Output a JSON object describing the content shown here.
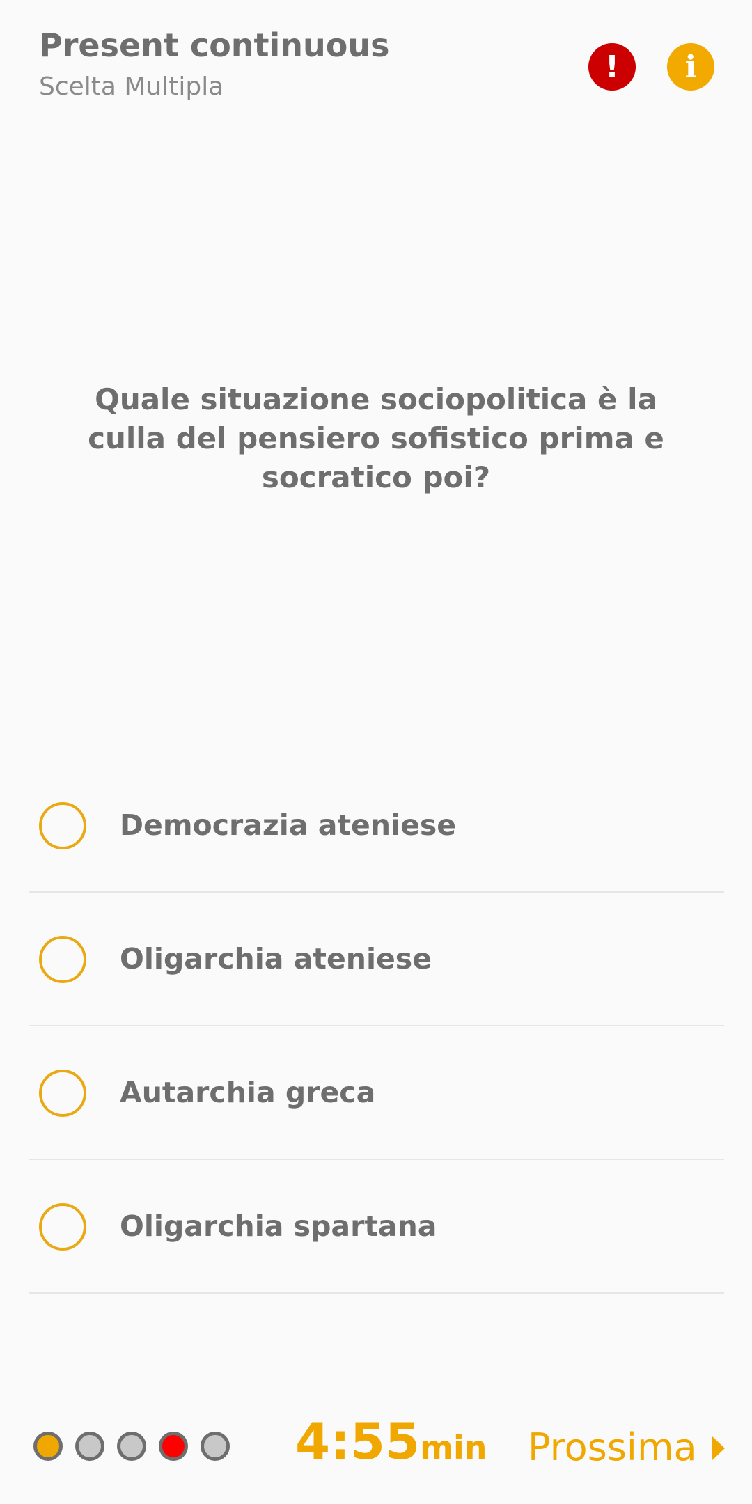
{
  "header": {
    "title": "Present continuous",
    "subtitle": "Scelta Multipla",
    "alert_icon": "exclamation-icon",
    "alert_glyph": "!",
    "info_icon": "info-icon",
    "info_glyph": "i"
  },
  "question": {
    "text": "Quale situazione sociopolitica è la culla del pensiero sofistico prima e socratico poi?"
  },
  "options": [
    {
      "label": "Democrazia ateniese"
    },
    {
      "label": "Oligarchia ateniese"
    },
    {
      "label": "Autarchia greca"
    },
    {
      "label": "Oligarchia spartana"
    }
  ],
  "footer": {
    "progress_dots": [
      {
        "state": "answered",
        "color": "#f0a800"
      },
      {
        "state": "pending",
        "color": "#c8c8c8"
      },
      {
        "state": "pending",
        "color": "#c8c8c8"
      },
      {
        "state": "current",
        "color": "#ff0000"
      },
      {
        "state": "pending",
        "color": "#c8c8c8"
      }
    ],
    "timer_value": "4:55",
    "timer_unit": "min",
    "next_label": "Prossima"
  },
  "colors": {
    "accent": "#f0a800",
    "alert": "#cc0000",
    "text": "#6e6e6e"
  }
}
